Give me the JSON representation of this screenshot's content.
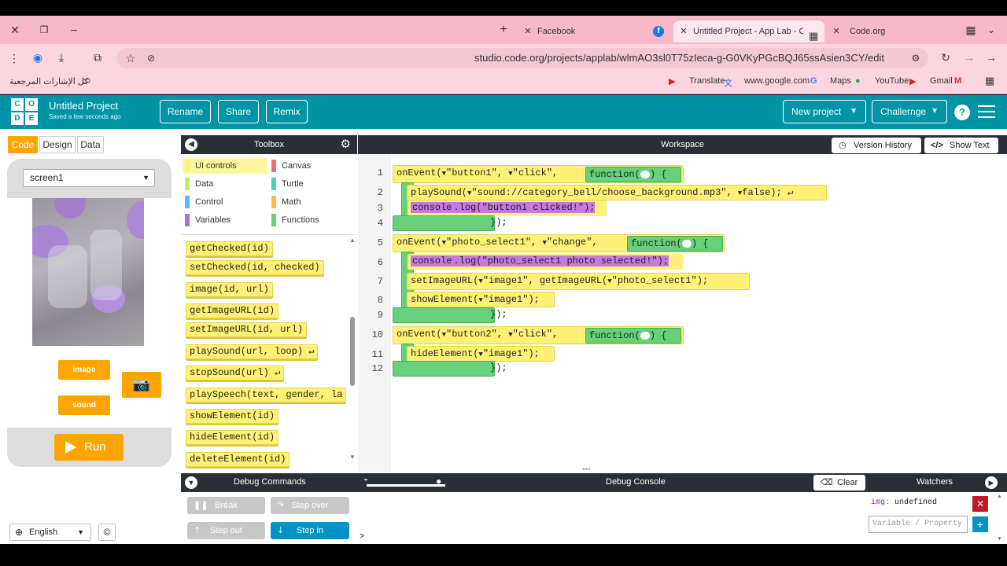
{
  "browser": {
    "tabs": [
      {
        "title": "Facebook",
        "icon": "facebook-icon",
        "active": false
      },
      {
        "title": "Untitled Project - App Lab - Co",
        "icon": "code-org-icon",
        "active": true
      },
      {
        "title": "Code.org",
        "icon": "code-org-icon",
        "active": false
      }
    ],
    "url": "studio.code.org/projects/applab/wlmAO3sl0T75zIeca-g-G0VKyPGcBQJ65ssAsien3CY/edit",
    "bookmarks": [
      "Translate",
      "www.google.com",
      "Maps",
      "YouTube",
      "Gmail"
    ],
    "bookmarks_folder": "كل الإشارات المرجعية"
  },
  "app": {
    "logo_letters": [
      "C",
      "O",
      "D",
      "E"
    ],
    "project_title": "Untitled Project",
    "saved_status": "Saved a few seconds ago",
    "header_buttons": [
      "Rename",
      "Share",
      "Remix"
    ],
    "new_project": "New project",
    "challenge": "Challernge",
    "help": "?"
  },
  "left": {
    "modes": [
      "Code",
      "Design",
      "Data"
    ],
    "active_mode": "Code",
    "screen": "screen1",
    "buttons": {
      "image": "image",
      "sound": "sound"
    },
    "run": "Run",
    "language": "English",
    "copyright": "©"
  },
  "toolbox": {
    "title": "Toolbox",
    "categories": [
      {
        "label": "UI controls",
        "color": "#fff176",
        "selected": true
      },
      {
        "label": "Canvas",
        "color": "#e57373"
      },
      {
        "label": "Data",
        "color": "#c5e86c"
      },
      {
        "label": "Turtle",
        "color": "#4dd0b0"
      },
      {
        "label": "Control",
        "color": "#64b5f6"
      },
      {
        "label": "Math",
        "color": "#ffb74d"
      },
      {
        "label": "Variables",
        "color": "#b26ed1"
      },
      {
        "label": "Functions",
        "color": "#66d17a"
      }
    ],
    "blocks": [
      "getChecked(id)",
      "setChecked(id, checked)",
      "image(id, url)",
      "getImageURL(id)",
      "setImageURL(id, url)",
      "playSound(url, loop) ↵",
      "stopSound(url) ↵",
      "playSpeech(text, gender, la",
      "showElement(id)",
      "hideElement(id)",
      "deleteElement(id)"
    ]
  },
  "workspace": {
    "title": "Workspace",
    "version_history": "Version History",
    "show_text": "Show Text",
    "line_numbers": [
      "1",
      "2",
      "3",
      "4",
      "5",
      "6",
      "7",
      "8",
      "9",
      "10",
      "11",
      "12"
    ],
    "code": {
      "l1_event": "onEvent(",
      "l1_id": "\"button1\",",
      "l1_evt": "\"click\",",
      "fn": "function(",
      "fn_end": ") {",
      "l2": "playSound(",
      "l2_url": "\"sound://category_bell/choose_background.mp3\",",
      "l2_false": "false); ↵",
      "l3_console": "console",
      "l3_log": ".log(",
      "l3_msg": "\"button1 clicked!\");",
      "close": "});",
      "l5_event": "onEvent(",
      "l5_id": "\"photo_select1\",",
      "l5_evt": "\"change\",",
      "l6_msg": "\"photo_select1 photo selected!\");",
      "l7": "setImageURL(",
      "l7_id": "\"image1\",",
      "l7_get": "getImageURL(",
      "l7_arg": "\"photo_select1\"",
      "l7_end": ");",
      "l8": "showElement(",
      "l8_id": "\"image1\");",
      "l10_event": "onEvent(",
      "l10_id": "\"button2\",",
      "l10_evt": "\"click\",",
      "l11": "hideElement(",
      "l11_id": "\"image1\");"
    }
  },
  "debug": {
    "commands_title": "Debug Commands",
    "console_title": "Debug Console",
    "watchers_title": "Watchers",
    "clear": "Clear",
    "buttons": [
      "Break",
      "Step over",
      "Step out",
      "Step in"
    ],
    "prompt": ">",
    "watch_name": "img:",
    "watch_value": "undefined",
    "watch_placeholder": "Variable / Property"
  }
}
